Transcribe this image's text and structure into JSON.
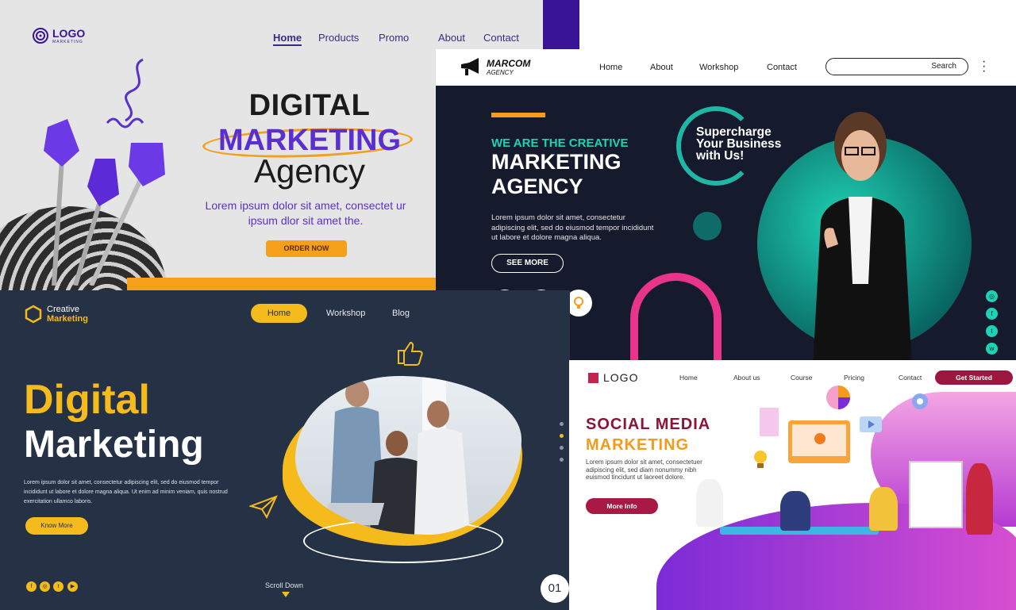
{
  "panel_a": {
    "logo_text": "LOGO",
    "logo_sub": "MARKETING",
    "nav": [
      "Home",
      "Products",
      "Promo",
      "About",
      "Contact"
    ],
    "title_line1": "DIGITAL",
    "title_line2": "MARKETING",
    "title_line3": "Agency",
    "body": "Lorem ipsum dolor sit amet, consectet ur ipsum dlor sit amet the.",
    "cta": "ORDER NOW",
    "colors": {
      "accent": "#5a2fd0",
      "orange": "#f4a01a"
    }
  },
  "panel_b": {
    "logo_text": "MARCOM",
    "logo_sub": "AGENCY",
    "nav": [
      "Home",
      "About",
      "Workshop",
      "Contact"
    ],
    "search_label": "Search",
    "tagline": "WE ARE THE CREATIVE",
    "title_line1": "MARKETING",
    "title_line2": "AGENCY",
    "body": "Lorem ipsum dolor sit amet, consectetur adipiscing elit, sed do eiusmod tempor incididunt ut labore et dolore magna aliqua.",
    "cta": "SEE MORE",
    "icons": [
      "target-icon",
      "chart-icon",
      "lightbulb-icon"
    ],
    "supercharge": [
      "Supercharge",
      "Your Business",
      "with Us!"
    ],
    "social_icons": [
      "instagram-icon",
      "facebook-icon",
      "twitter-icon",
      "whatsapp-icon"
    ],
    "colors": {
      "teal": "#1dd3b5",
      "pink": "#e8348b",
      "orange": "#f79b1c"
    }
  },
  "panel_c": {
    "logo_line1": "Creative",
    "logo_line2": "Marketing",
    "nav_active": "Home",
    "nav": [
      "Workshop",
      "Blog"
    ],
    "title_line1": "Digital",
    "title_line2": "Marketing",
    "body": "Lorem ipsum dolor sit amet, consectetur adipiscing elit, sed do eiusmod tempor incididunt ut labore et dolore magna aliqua. Ut enim ad minim veniam, quis nostrud exercitation ullamco laboris.",
    "cta": "Know More",
    "scroll": "Scroll Down",
    "page_number": "01",
    "social_icons": [
      "facebook-icon",
      "instagram-icon",
      "twitter-icon",
      "youtube-icon"
    ],
    "colors": {
      "yellow": "#f5bb1d",
      "bg": "#253145"
    }
  },
  "panel_d": {
    "logo_text": "LOGO",
    "nav": [
      "Home",
      "About us",
      "Course",
      "Pricing",
      "Contact"
    ],
    "cta_top": "Get Started",
    "title_line1": "SOCIAL MEDIA",
    "title_line2": "MARKETING",
    "body": "Lorem ipsum dolor sit amet, consectetuer adipiscing elit, sed diam nonummy nibh euismod tincidunt ut laoreet dolore.",
    "cta": "More Info",
    "colors": {
      "maroon": "#8a1536",
      "orange": "#f29b1c",
      "purple": "#7b2bd7"
    }
  }
}
